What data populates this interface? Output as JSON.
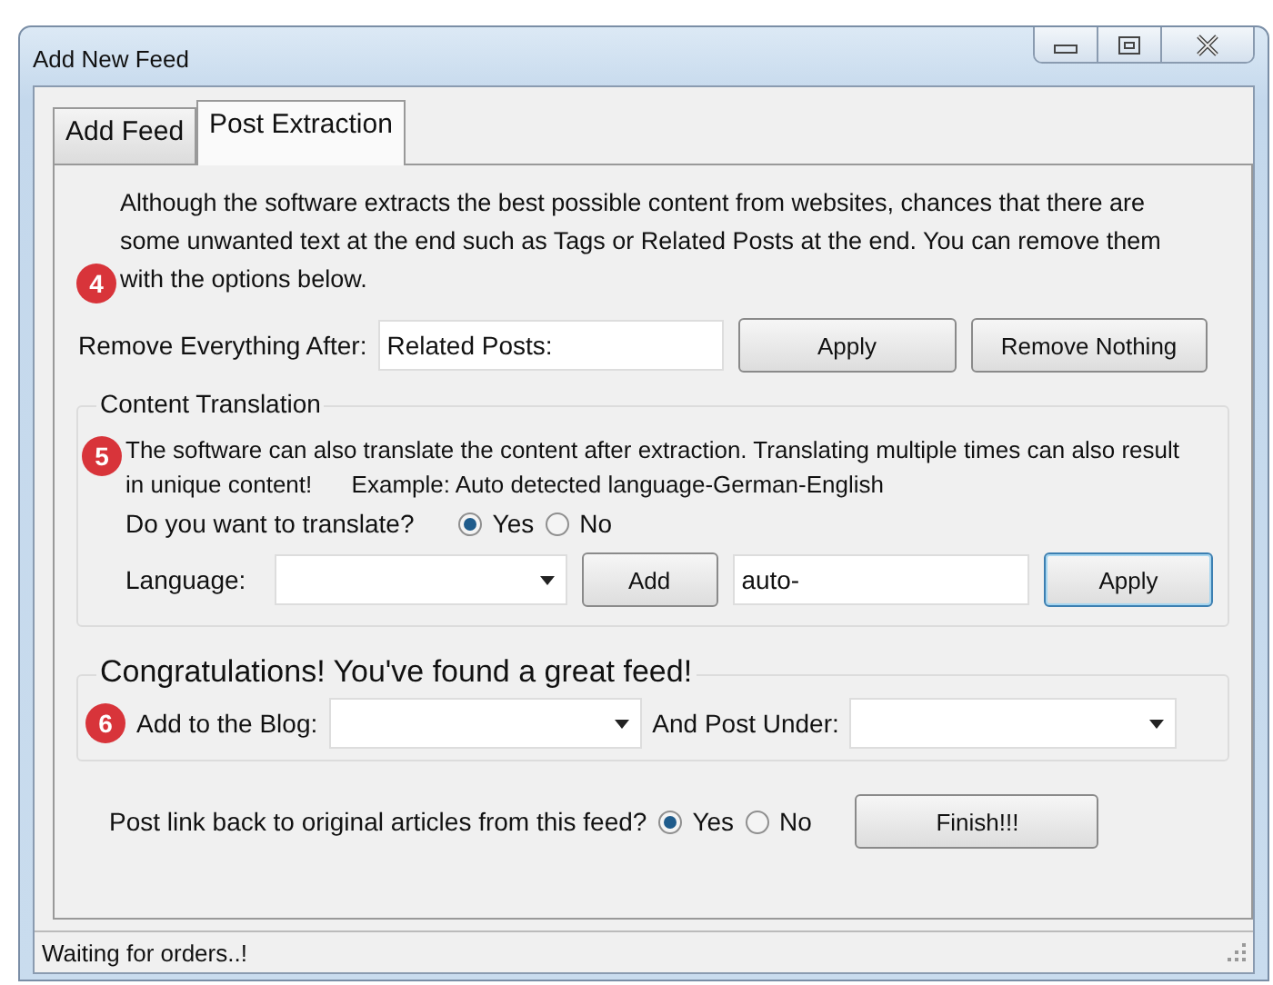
{
  "window": {
    "title": "Add New Feed"
  },
  "tabs": [
    {
      "label": "Add Feed",
      "selected": false
    },
    {
      "label": "Post Extraction",
      "selected": true
    }
  ],
  "removal": {
    "badge": "4",
    "description": "Although the software extracts the best possible content from websites, chances that there are some unwanted text at the end such as Tags or Related Posts at the end. You can remove them with the options below.",
    "field_label": "Remove Everything After:",
    "value": "Related Posts:",
    "apply_button": "Apply",
    "nothing_button": "Remove Nothing"
  },
  "translation": {
    "title": "Content Translation",
    "badge": "5",
    "description": "The software can also translate the content after extraction. Translating multiple times can also result in unique content!      Example: Auto detected language-German-English",
    "question": "Do you want to translate?",
    "options": [
      {
        "label": "Yes",
        "selected": true
      },
      {
        "label": "No",
        "selected": false
      }
    ],
    "language_label": "Language:",
    "add_button": "Add",
    "value": "auto-",
    "apply_button": "Apply"
  },
  "blog": {
    "title": "Congratulations! You've found a great feed!",
    "badge": "6",
    "blog_label": "Add to the Blog:",
    "post_label": "And Post Under:"
  },
  "link_back": {
    "question": "Post link back to original articles from this feed?",
    "options": [
      {
        "label": "Yes",
        "selected": true
      },
      {
        "label": "No",
        "selected": false
      }
    ]
  },
  "finish_button": "Finish!!!",
  "status_bar": "Waiting for orders..!"
}
